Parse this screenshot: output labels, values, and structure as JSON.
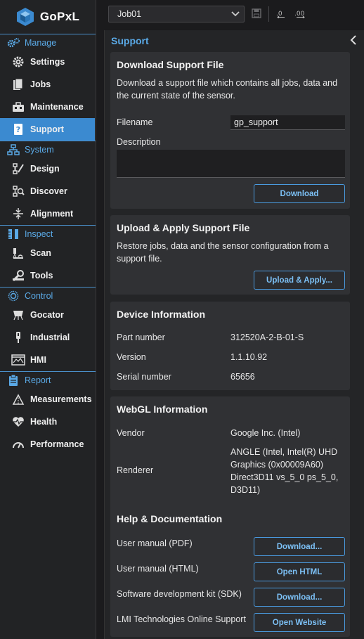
{
  "app": {
    "name": "GoPxL"
  },
  "colors": {
    "accent": "#3b8ad0",
    "accent_text": "#5aa9e6",
    "button_text": "#7cc0f5"
  },
  "sidebar": {
    "sections": [
      {
        "label": "Manage",
        "icon": "gears-icon",
        "items": [
          {
            "label": "Settings",
            "icon": "gear-icon"
          },
          {
            "label": "Jobs",
            "icon": "document-icon"
          },
          {
            "label": "Maintenance",
            "icon": "toolbox-icon"
          },
          {
            "label": "Support",
            "icon": "book-question-icon",
            "active": true
          }
        ]
      },
      {
        "label": "System",
        "icon": "network-icon",
        "items": [
          {
            "label": "Design",
            "icon": "design-icon"
          },
          {
            "label": "Discover",
            "icon": "discover-icon"
          },
          {
            "label": "Alignment",
            "icon": "alignment-icon"
          }
        ]
      },
      {
        "label": "Inspect",
        "icon": "ruler-icon",
        "items": [
          {
            "label": "Scan",
            "icon": "scan-icon"
          },
          {
            "label": "Tools",
            "icon": "tools-icon"
          }
        ]
      },
      {
        "label": "Control",
        "icon": "control-icon",
        "items": [
          {
            "label": "Gocator",
            "icon": "gocator-icon"
          },
          {
            "label": "Industrial",
            "icon": "industrial-icon"
          },
          {
            "label": "HMI",
            "icon": "hmi-icon"
          }
        ]
      },
      {
        "label": "Report",
        "icon": "clipboard-icon",
        "items": [
          {
            "label": "Measurements",
            "icon": "measurements-icon"
          },
          {
            "label": "Health",
            "icon": "heart-icon"
          },
          {
            "label": "Performance",
            "icon": "gauge-icon"
          }
        ]
      }
    ]
  },
  "toolbar": {
    "job": "Job01"
  },
  "panel": {
    "title": "Support",
    "download": {
      "title": "Download Support File",
      "description": "Download a support file which contains all jobs, data and the current state of the sensor.",
      "filename_label": "Filename",
      "filename_value": "gp_support",
      "description_label": "Description",
      "button": "Download"
    },
    "upload": {
      "title": "Upload & Apply Support File",
      "description": "Restore jobs, data and the sensor configuration from a support file.",
      "button": "Upload & Apply..."
    },
    "device": {
      "title": "Device Information",
      "part_label": "Part number",
      "part_value": "312520A-2-B-01-S",
      "version_label": "Version",
      "version_value": "1.1.10.92",
      "serial_label": "Serial number",
      "serial_value": "65656"
    },
    "webgl": {
      "title": "WebGL Information",
      "vendor_label": "Vendor",
      "vendor_value": "Google Inc. (Intel)",
      "renderer_label": "Renderer",
      "renderer_line1": "ANGLE (Intel, Intel(R) UHD",
      "renderer_line2": "Graphics (0x00009A60)",
      "renderer_line3": "Direct3D11 vs_5_0 ps_5_0,",
      "renderer_line4": "D3D11)"
    },
    "help": {
      "title": "Help & Documentation",
      "pdf_label": "User manual (PDF)",
      "pdf_button": "Download...",
      "html_label": "User manual (HTML)",
      "html_button": "Open HTML",
      "sdk_label": "Software development kit (SDK)",
      "sdk_button": "Download...",
      "online_label": "LMI Technologies Online Support",
      "online_button": "Open Website"
    }
  }
}
